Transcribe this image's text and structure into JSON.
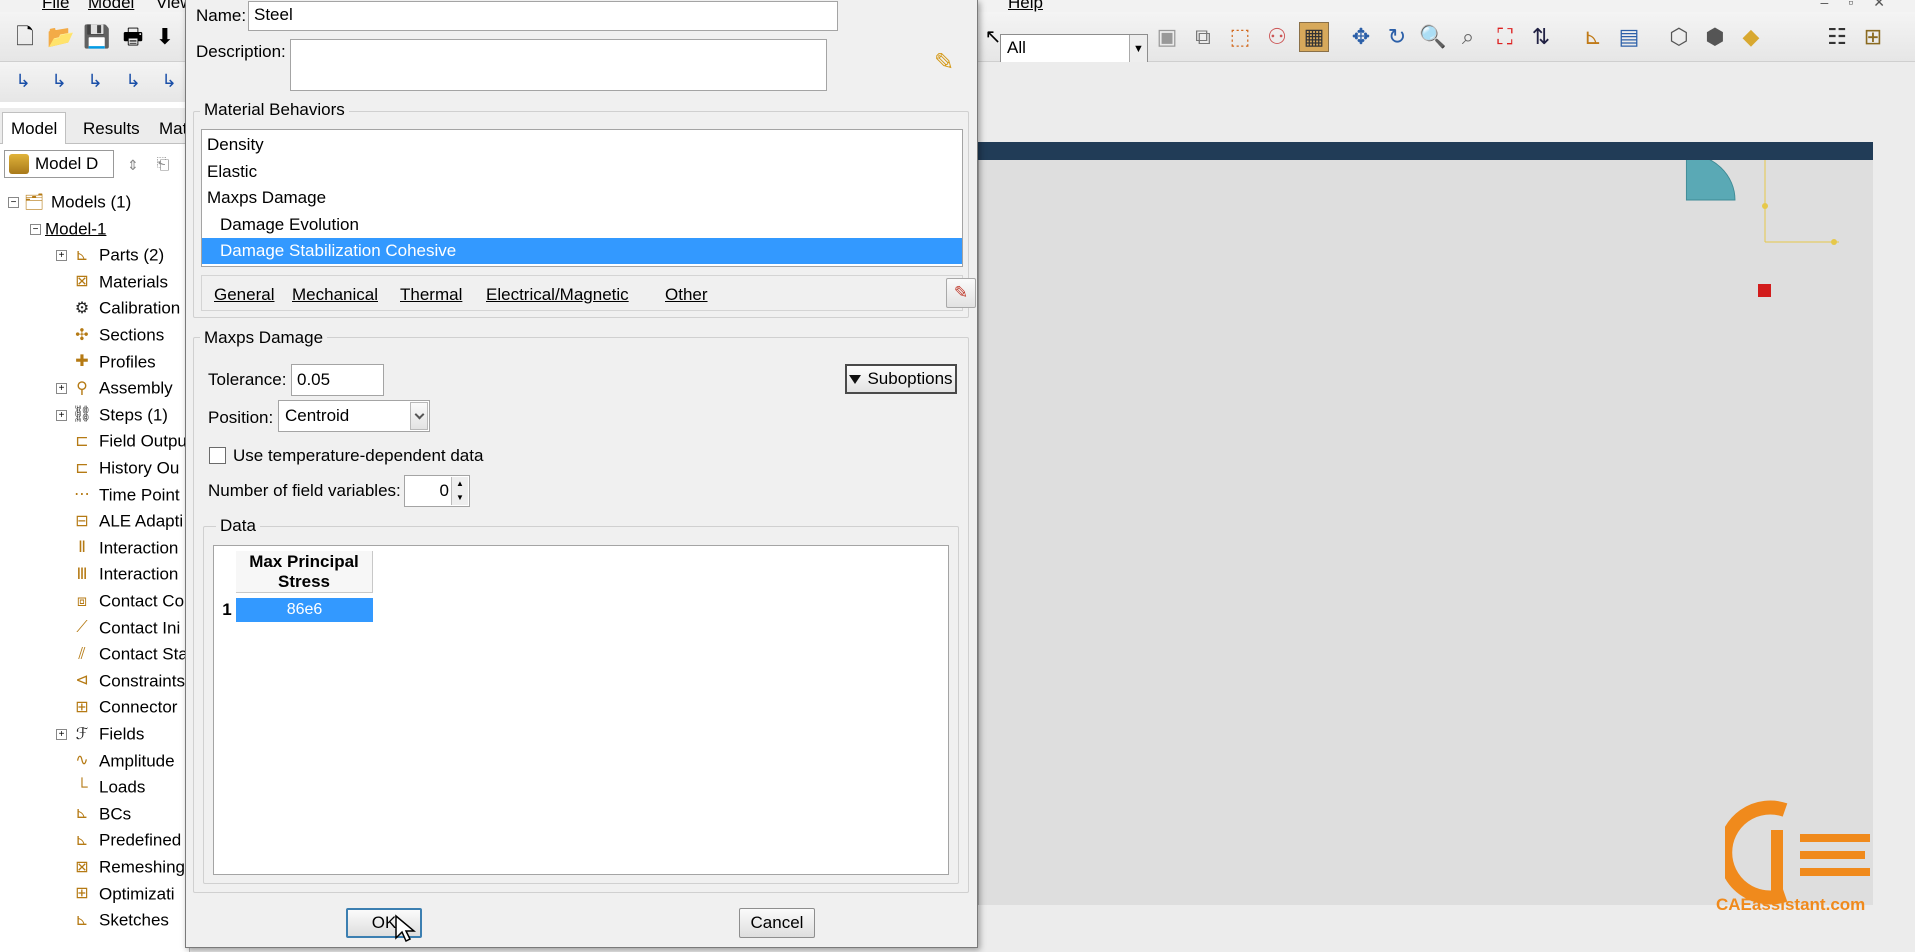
{
  "menubar": {
    "items": [
      "File",
      "Model",
      "View"
    ],
    "right_items": [
      "Help"
    ]
  },
  "toolbar": {
    "selection_filter": "All"
  },
  "model_tree": {
    "tabs": [
      "Model",
      "Results",
      "Mat"
    ],
    "db_selector": "Model D",
    "rows": [
      {
        "label": "Models (1)",
        "icon": "models-icon",
        "expander": "−"
      },
      {
        "label": "Model-1",
        "icon": "",
        "expander": "−"
      },
      {
        "label": "Parts (2)",
        "icon": "parts-icon",
        "expander": "+"
      },
      {
        "label": "Materials",
        "icon": "materials-icon",
        "expander": ""
      },
      {
        "label": "Calibration",
        "icon": "calibration-icon",
        "expander": ""
      },
      {
        "label": "Sections",
        "icon": "sections-icon",
        "expander": ""
      },
      {
        "label": "Profiles",
        "icon": "profiles-icon",
        "expander": ""
      },
      {
        "label": "Assembly",
        "icon": "assembly-icon",
        "expander": "+"
      },
      {
        "label": "Steps (1)",
        "icon": "steps-icon",
        "expander": "+"
      },
      {
        "label": "Field Outpu",
        "icon": "field-output-icon",
        "expander": ""
      },
      {
        "label": "History Ou",
        "icon": "history-output-icon",
        "expander": ""
      },
      {
        "label": "Time Point",
        "icon": "time-points-icon",
        "expander": ""
      },
      {
        "label": "ALE Adapti",
        "icon": "ale-icon",
        "expander": ""
      },
      {
        "label": "Interaction",
        "icon": "interaction-icon",
        "expander": ""
      },
      {
        "label": "Interaction",
        "icon": "interaction-prop-icon",
        "expander": ""
      },
      {
        "label": "Contact Co",
        "icon": "contact-controls-icon",
        "expander": ""
      },
      {
        "label": "Contact Ini",
        "icon": "contact-init-icon",
        "expander": ""
      },
      {
        "label": "Contact Sta",
        "icon": "contact-stab-icon",
        "expander": ""
      },
      {
        "label": "Constraints",
        "icon": "constraints-icon",
        "expander": ""
      },
      {
        "label": "Connector",
        "icon": "connector-icon",
        "expander": ""
      },
      {
        "label": "Fields",
        "icon": "fields-icon",
        "expander": "+"
      },
      {
        "label": "Amplitude",
        "icon": "amplitude-icon",
        "expander": ""
      },
      {
        "label": "Loads",
        "icon": "loads-icon",
        "expander": ""
      },
      {
        "label": "BCs",
        "icon": "bcs-icon",
        "expander": ""
      },
      {
        "label": "Predefined",
        "icon": "predefined-icon",
        "expander": ""
      },
      {
        "label": "Remeshing",
        "icon": "remeshing-icon",
        "expander": ""
      },
      {
        "label": "Optimizati",
        "icon": "optimization-icon",
        "expander": ""
      },
      {
        "label": "Sketches",
        "icon": "sketches-icon",
        "expander": ""
      }
    ]
  },
  "dialog": {
    "name_label": "Name:",
    "name_value": "Steel",
    "description_label": "Description:",
    "description_value": "",
    "behaviors_title": "Material Behaviors",
    "behaviors": [
      {
        "label": "Density",
        "sub": false,
        "selected": false
      },
      {
        "label": "Elastic",
        "sub": false,
        "selected": false
      },
      {
        "label": "Maxps Damage",
        "sub": false,
        "selected": false
      },
      {
        "label": "Damage Evolution",
        "sub": true,
        "selected": false
      },
      {
        "label": "Damage Stabilization Cohesive",
        "sub": true,
        "selected": true
      }
    ],
    "menus": [
      "General",
      "Mechanical",
      "Thermal",
      "Electrical/Magnetic",
      "Other"
    ],
    "section_title": "Maxps Damage",
    "tolerance_label": "Tolerance:",
    "tolerance_value": "0.05",
    "suboptions_label": "Suboptions",
    "position_label": "Position:",
    "position_value": "Centroid",
    "temp_dependent_label": "Use temperature-dependent data",
    "temp_dependent_checked": false,
    "field_vars_label": "Number of field variables:",
    "field_vars_value": "0",
    "data_title": "Data",
    "table": {
      "column_header": "Max Principal Stress",
      "row_index": "1",
      "cell_value": "86e6"
    },
    "ok_label": "OK",
    "cancel_label": "Cancel"
  },
  "watermark": {
    "text": "CAEassistant.com"
  },
  "colors": {
    "selection": "#3399ff",
    "viewport_frame": "#213c57",
    "viewport_bg": "#dedede",
    "brand_orange": "#f08a1c",
    "part_teal": "#5aa9b5"
  }
}
